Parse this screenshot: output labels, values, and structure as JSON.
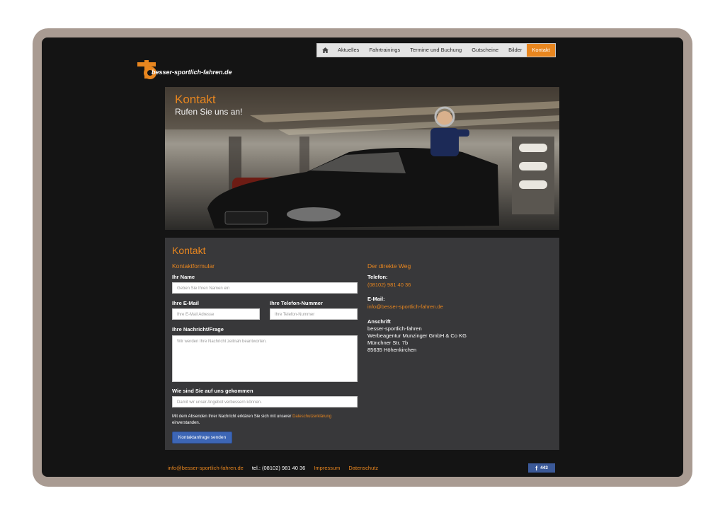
{
  "nav": {
    "home_icon": "home-icon",
    "items": [
      "Aktuelles",
      "Fahrtrainings",
      "Termine und Buchung",
      "Gutscheine",
      "Bilder",
      "Kontakt"
    ],
    "active": "Kontakt"
  },
  "logo": {
    "text": "besser-sportlich-fahren.de"
  },
  "hero": {
    "title": "Kontakt",
    "subtitle": "Rufen Sie uns an!"
  },
  "content": {
    "title": "Kontakt",
    "form": {
      "section_title": "Kontaktformular",
      "name_label": "Ihr Name",
      "name_placeholder": "Geben Sie Ihren Namen ein",
      "email_label": "Ihre E-Mail",
      "email_placeholder": "Ihre E-Mail Adresse",
      "phone_label": "Ihre Telefon-Nummer",
      "phone_placeholder": "Ihre Telefon-Nummer",
      "message_label": "Ihre Nachricht/Frage",
      "message_placeholder": "Wir werden Ihre Nachricht zeitnah beantworten.",
      "source_label": "Wie sind Sie auf uns gekommen",
      "source_placeholder": "Damit wir unser Angebot verbessern können.",
      "privacy_text_before": "Mit dem Absenden Ihrer Nachricht erklären Sie sich mit unserer ",
      "privacy_link": "Dateschutzerklärung",
      "privacy_text_after": "einverstanden.",
      "submit": "Kontaktanfrage senden"
    },
    "direct": {
      "section_title": "Der direkte Weg",
      "phone_label": "Telefon:",
      "phone_value": "(08102) 981 40 36",
      "email_label": "E-Mail:",
      "email_value": "info@besser-sportlich-fahren.de",
      "address_label": "Anschrift",
      "address_lines": [
        "besser-sportlich-fahren",
        "Werbeagentur Munzinger GmbH & Co KG",
        "Münchner Str. 7b",
        "85635 Höhenkirchen"
      ]
    }
  },
  "footer": {
    "email": "info@besser-sportlich-fahren.de",
    "phone": "tel.: (08102) 981 40 36",
    "impressum": "Impressum",
    "datenschutz": "Datenschutz",
    "facebook_count": "443"
  },
  "colors": {
    "accent": "#e8861f",
    "panel": "#38383a",
    "button": "#3d66b5",
    "facebook": "#3b5998"
  }
}
